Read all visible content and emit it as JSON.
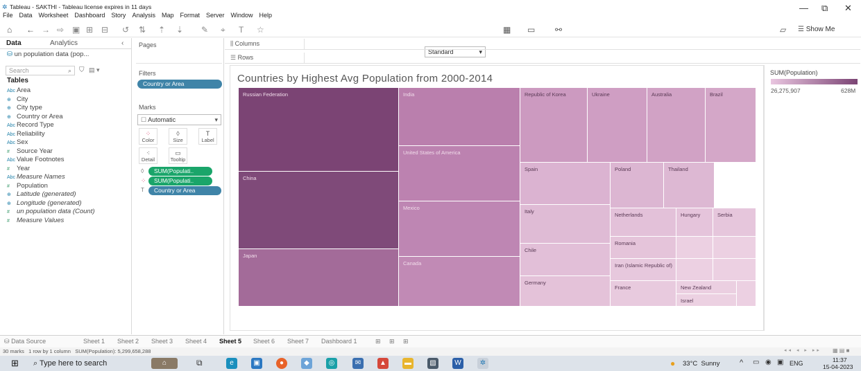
{
  "window": {
    "title": "Tableau - SAKTHI - Tableau license expires in 11 days",
    "menu": [
      "File",
      "Data",
      "Worksheet",
      "Dashboard",
      "Story",
      "Analysis",
      "Map",
      "Format",
      "Server",
      "Window",
      "Help"
    ]
  },
  "toolbar": {
    "fit_select": "Standard",
    "show_me_label": "Show Me"
  },
  "left_pane": {
    "tab_data": "Data",
    "tab_analytics": "Analytics",
    "datasource": "un population data (pop...",
    "search_placeholder": "Search",
    "tables_label": "Tables",
    "fields": [
      {
        "type": "Abc",
        "name": "Area"
      },
      {
        "type": "globe",
        "name": "City"
      },
      {
        "type": "globe",
        "name": "City type"
      },
      {
        "type": "globe",
        "name": "Country or Area"
      },
      {
        "type": "Abc",
        "name": "Record Type"
      },
      {
        "type": "Abc",
        "name": "Reliability"
      },
      {
        "type": "Abc",
        "name": "Sex"
      },
      {
        "type": "#",
        "name": "Source Year"
      },
      {
        "type": "Abc",
        "name": "Value Footnotes"
      },
      {
        "type": "#",
        "name": "Year"
      },
      {
        "type": "Abc",
        "name": "Measure Names"
      },
      {
        "type": "#",
        "name": "Population"
      },
      {
        "type": "globe",
        "name": "Latitude (generated)"
      },
      {
        "type": "globe",
        "name": "Longitude (generated)"
      },
      {
        "type": "#",
        "name": "un population data (Count)"
      },
      {
        "type": "#",
        "name": "Measure Values"
      }
    ]
  },
  "shelves": {
    "pages_label": "Pages",
    "filters_label": "Filters",
    "filter_pill": "Country or Area",
    "marks_label": "Marks",
    "mark_type": "Automatic",
    "mark_buttons": [
      "Color",
      "Size",
      "Label",
      "Detail",
      "Tooltip"
    ],
    "mark_pills": [
      "SUM(Populati..",
      "SUM(Populati..",
      "Country or Area"
    ],
    "columns_label": "Columns",
    "rows_label": "Rows"
  },
  "viz": {
    "title": "Countries by Highest Avg Population from 2000-2014"
  },
  "legend": {
    "title": "SUM(Population)",
    "min": "26,275,907",
    "max": "628M",
    "color_low": "#e9c6e0",
    "color_high": "#7b4474"
  },
  "chart_data": {
    "type": "treemap",
    "title": "Countries by Highest Avg Population from 2000-2014",
    "labels": [
      "Russian Federation",
      "China",
      "Japan",
      "India",
      "United States of America",
      "Mexico",
      "Canada",
      "Republic of Korea",
      "Ukraine",
      "Australia",
      "Brazil",
      "Spain",
      "Poland",
      "Thailand",
      "Italy",
      "Netherlands",
      "Hungary",
      "Serbia",
      "Chile",
      "Romania",
      "Iran (Islamic Republic of)",
      "Germany",
      "France",
      "New Zealand",
      "Israel"
    ]
  },
  "bottom": {
    "data_source_tab": "Data Source",
    "sheets": [
      "Sheet 1",
      "Sheet 2",
      "Sheet 3",
      "Sheet 4",
      "Sheet 5",
      "Sheet 6",
      "Sheet 7",
      "Dashboard 1"
    ],
    "active_sheet": "Sheet 5",
    "status": "30 marks   1 row by 1 column   SUM(Population): 5,299,658,288"
  },
  "taskbar": {
    "search_placeholder": "Type here to search",
    "weather": "33°C  Sunny",
    "lang": "ENG",
    "time": "11:37",
    "date": "15-04-2023"
  }
}
